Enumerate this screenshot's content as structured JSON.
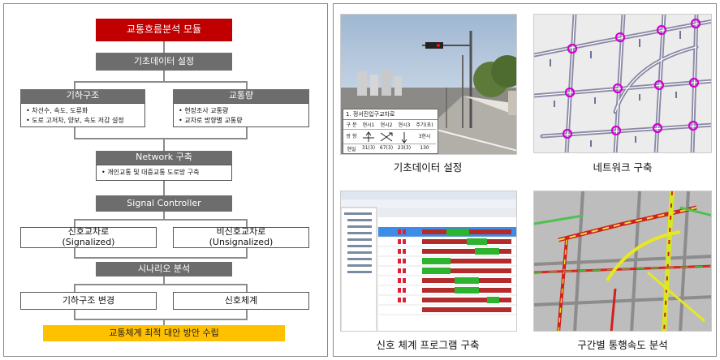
{
  "flow": {
    "module_title": "교통흐름분석 모듈",
    "basic_data": "기초데이터 설정",
    "geometry": {
      "title": "기하구조",
      "items": [
        "차선수, 속도, 도류화",
        "도로 고저차, 양보, 속도 저감 설정"
      ]
    },
    "traffic": {
      "title": "교통량",
      "items": [
        "현장조사 교통량",
        "교차로 방향별 교통량"
      ]
    },
    "network": {
      "title": "Network 구축",
      "items": [
        "개인교통 및 대중교통 도로망 구축"
      ]
    },
    "signal_controller": "Signal Controller",
    "signalized": "신호교차로\n(Signalized)",
    "unsignalized": "비신호교차로\n(Unsignalized)",
    "scenario": "시나리오 분석",
    "geometry_change": "기하구조 변경",
    "signal_system": "신호체계",
    "final": "교통체계 최적 대안 방안 수립"
  },
  "thumbnails": {
    "basic_data_caption": "기초데이터 설정",
    "network_caption": "네트워크 구축",
    "signal_program_caption": "신호 체계 프로그램 구축",
    "speed_caption": "구간별 통행속도 분석",
    "intersection_table": {
      "title": "1. 정서진입구교차로",
      "headers": [
        "구 분",
        "현시1",
        "현시2",
        "현시3",
        "주기(초)"
      ],
      "row_direction_label": "방 향",
      "cycle": "3현시",
      "row_time_label": "현일",
      "times": [
        "31(3)",
        "67(3)",
        "23(3)",
        "130"
      ]
    }
  }
}
